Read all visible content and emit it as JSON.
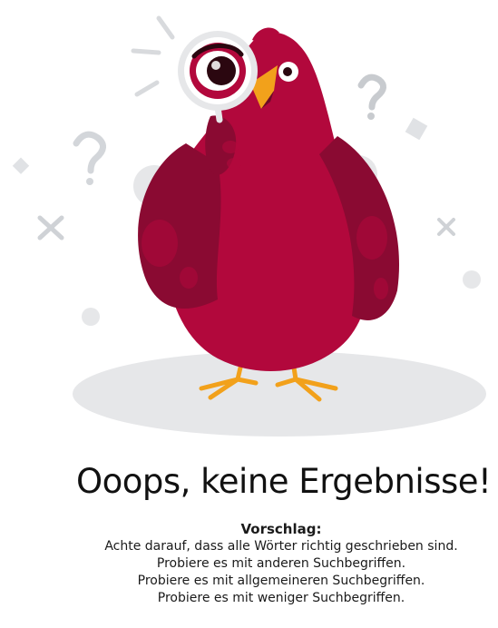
{
  "empty_state": {
    "title": "Ooops, keine Ergebnisse!",
    "suggestion_heading": "Vorschlag:",
    "tips": [
      "Achte darauf, dass alle Wörter richtig geschrieben sind.",
      "Probiere es mit anderen Suchbegriffen.",
      "Probiere es mit allgemeineren Suchbegriffen.",
      "Probiere es mit weniger Suchbegriffen."
    ]
  },
  "illustration": {
    "icon": "bird-with-magnifying-glass",
    "colors": {
      "bird": "#b2083c",
      "bird_dark": "#8a0a32",
      "beak_feet": "#f2a11b",
      "decor": "#d8dadd"
    }
  }
}
